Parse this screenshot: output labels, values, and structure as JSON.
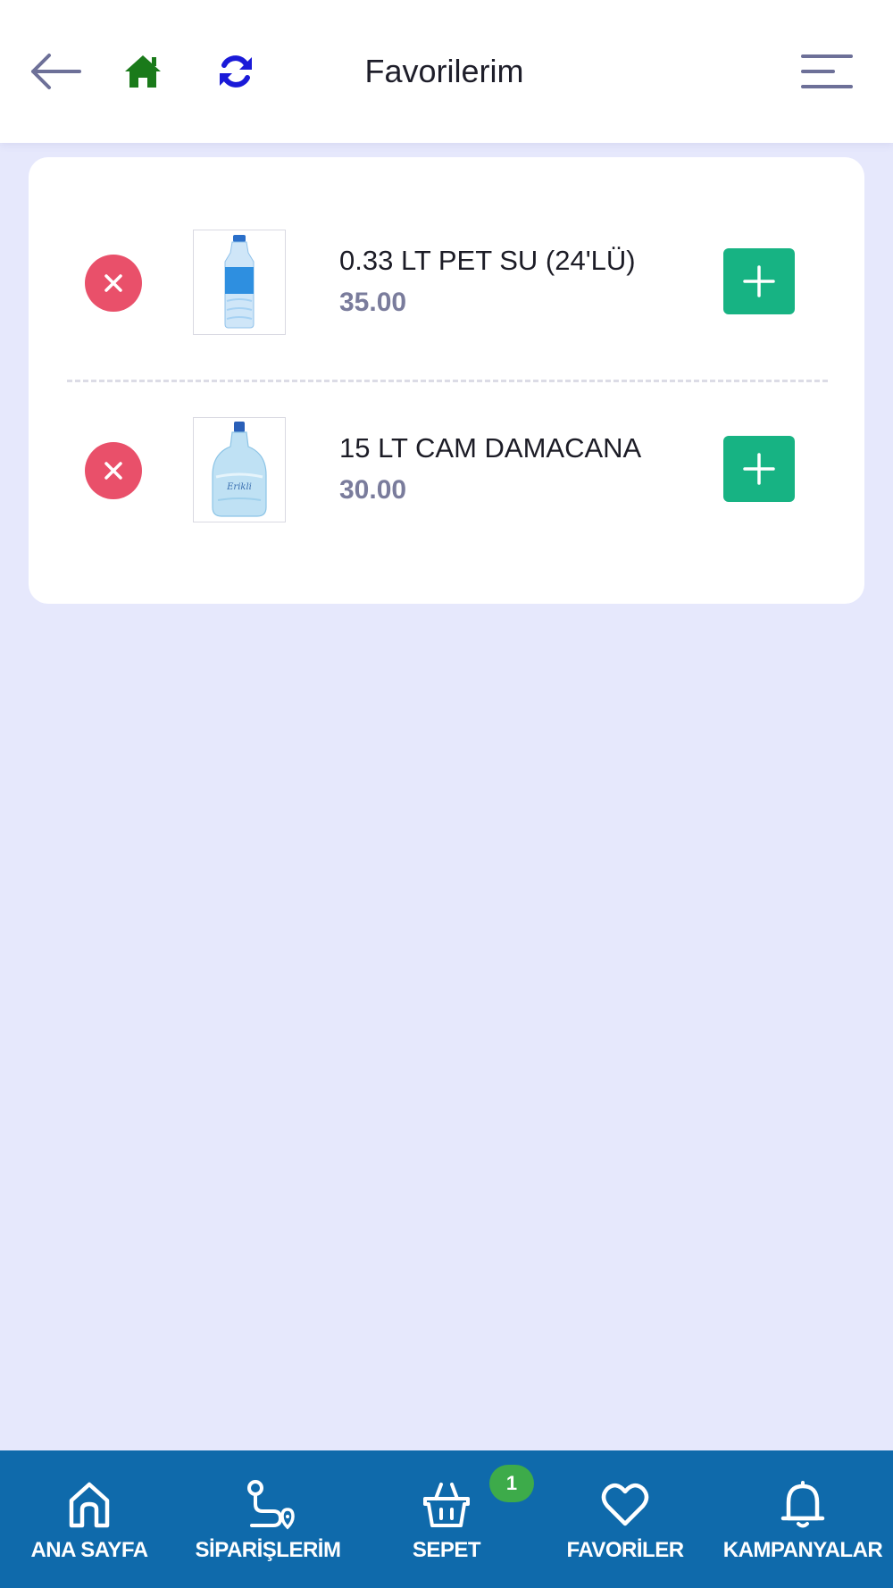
{
  "header": {
    "title": "Favorilerim",
    "back_icon": "arrow-left-icon",
    "home_icon": "home-icon",
    "refresh_icon": "refresh-icon",
    "menu_icon": "menu-icon"
  },
  "favorites": [
    {
      "name": "0.33 LT PET SU (24'LÜ)",
      "price": "35.00",
      "image": "small-water-bottle-image"
    },
    {
      "name": "15 LT CAM DAMACANA",
      "price": "30.00",
      "image": "glass-carboy-image"
    }
  ],
  "bottom_nav": {
    "items": [
      {
        "label": "ANA SAYFA",
        "icon": "home-outline-icon"
      },
      {
        "label": "SİPARİŞLERİM",
        "icon": "route-icon"
      },
      {
        "label": "SEPET",
        "icon": "basket-icon"
      },
      {
        "label": "FAVORİLER",
        "icon": "heart-icon"
      },
      {
        "label": "KAMPANYALAR",
        "icon": "bell-icon"
      }
    ],
    "cart_badge": "1"
  },
  "colors": {
    "background": "#e6e8fc",
    "nav_bar": "#0f6aab",
    "remove": "#e9506a",
    "add": "#17b383",
    "badge": "#3dab4a",
    "home_icon": "#1a7a1a",
    "refresh_icon": "#1a1ad8",
    "price": "#7a7c9c"
  }
}
